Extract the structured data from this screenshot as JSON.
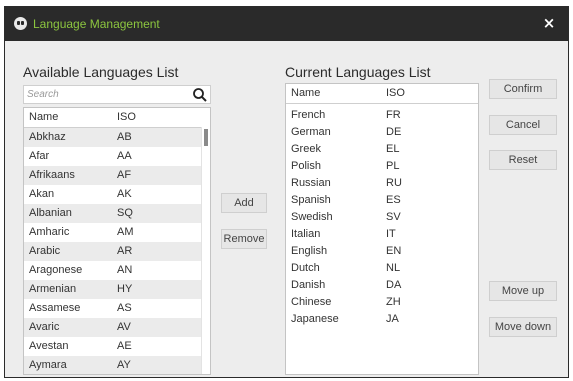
{
  "window": {
    "title": "Language Management",
    "close_glyph": "×",
    "icon": "app-icon"
  },
  "available": {
    "title": "Available Languages List",
    "search_placeholder": "Search",
    "columns": [
      "Name",
      "ISO"
    ],
    "rows": [
      [
        "Abkhaz",
        "AB"
      ],
      [
        "Afar",
        "AA"
      ],
      [
        "Afrikaans",
        "AF"
      ],
      [
        "Akan",
        "AK"
      ],
      [
        "Albanian",
        "SQ"
      ],
      [
        "Amharic",
        "AM"
      ],
      [
        "Arabic",
        "AR"
      ],
      [
        "Aragonese",
        "AN"
      ],
      [
        "Armenian",
        "HY"
      ],
      [
        "Assamese",
        "AS"
      ],
      [
        "Avaric",
        "AV"
      ],
      [
        "Avestan",
        "AE"
      ],
      [
        "Aymara",
        "AY"
      ]
    ]
  },
  "middle": {
    "add_label": "Add",
    "remove_label": "Remove"
  },
  "current": {
    "title": "Current Languages List",
    "columns": [
      "Name",
      "ISO"
    ],
    "rows": [
      [
        "French",
        "FR"
      ],
      [
        "German",
        "DE"
      ],
      [
        "Greek",
        "EL"
      ],
      [
        "Polish",
        "PL"
      ],
      [
        "Russian",
        "RU"
      ],
      [
        "Spanish",
        "ES"
      ],
      [
        "Swedish",
        "SV"
      ],
      [
        "Italian",
        "IT"
      ],
      [
        "English",
        "EN"
      ],
      [
        "Dutch",
        "NL"
      ],
      [
        "Danish",
        "DA"
      ],
      [
        "Chinese",
        "ZH"
      ],
      [
        "Japanese",
        "JA"
      ]
    ]
  },
  "actions": {
    "confirm_label": "Confirm",
    "cancel_label": "Cancel",
    "reset_label": "Reset",
    "move_up_label": "Move up",
    "move_down_label": "Move down"
  },
  "colors": {
    "title_text": "#8cc63f",
    "titlebar": "#2a2a2a",
    "dialog_bg": "#ededed"
  }
}
